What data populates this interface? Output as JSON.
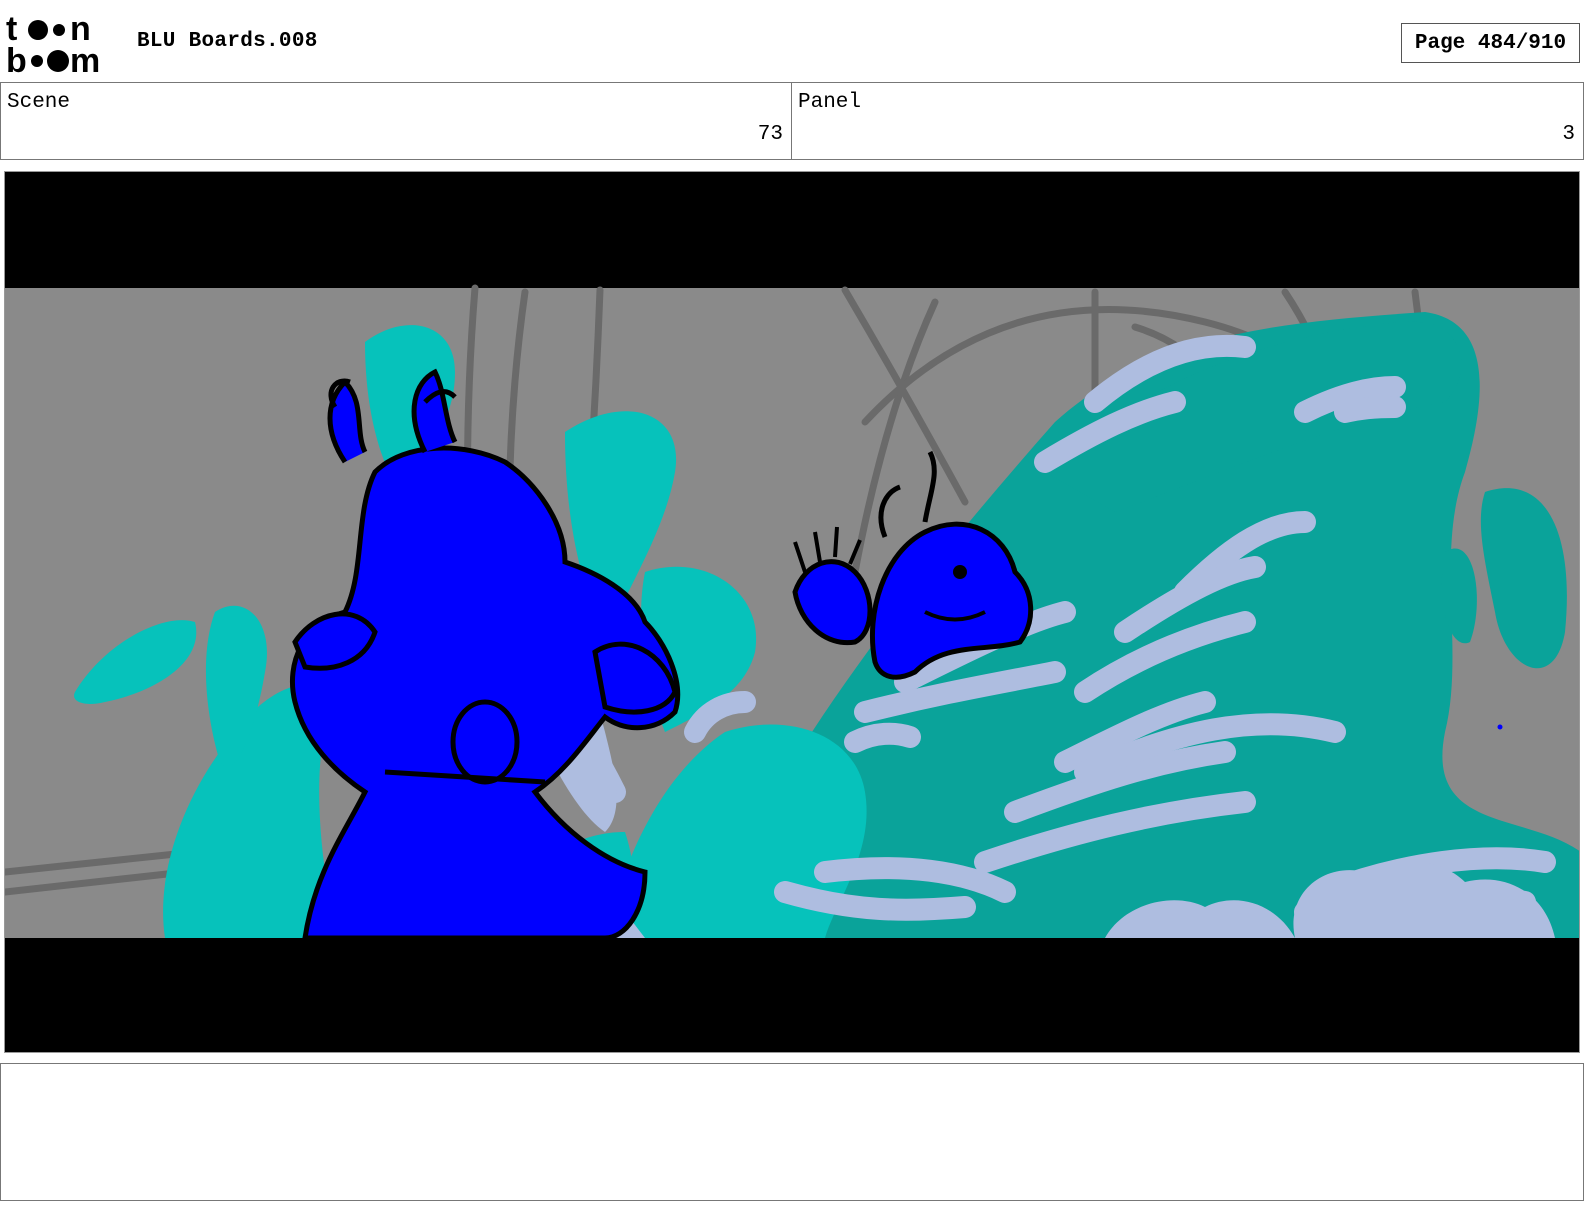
{
  "header": {
    "logo_text_top": "toon",
    "logo_text_bottom": "boom",
    "title": "BLU Boards.008",
    "page": "Page 484/910"
  },
  "info": {
    "scene_label": "Scene",
    "scene_value": "73",
    "panel_label": "Panel",
    "panel_value": "3"
  },
  "notes": {
    "text": ""
  },
  "colors": {
    "character_blue": "#0000ff",
    "water_teal": "#0aa39a",
    "water_cyan": "#06c2bb",
    "foam": "#aebde0",
    "background_gray": "#8a8a8a",
    "letterbox": "#000000"
  }
}
